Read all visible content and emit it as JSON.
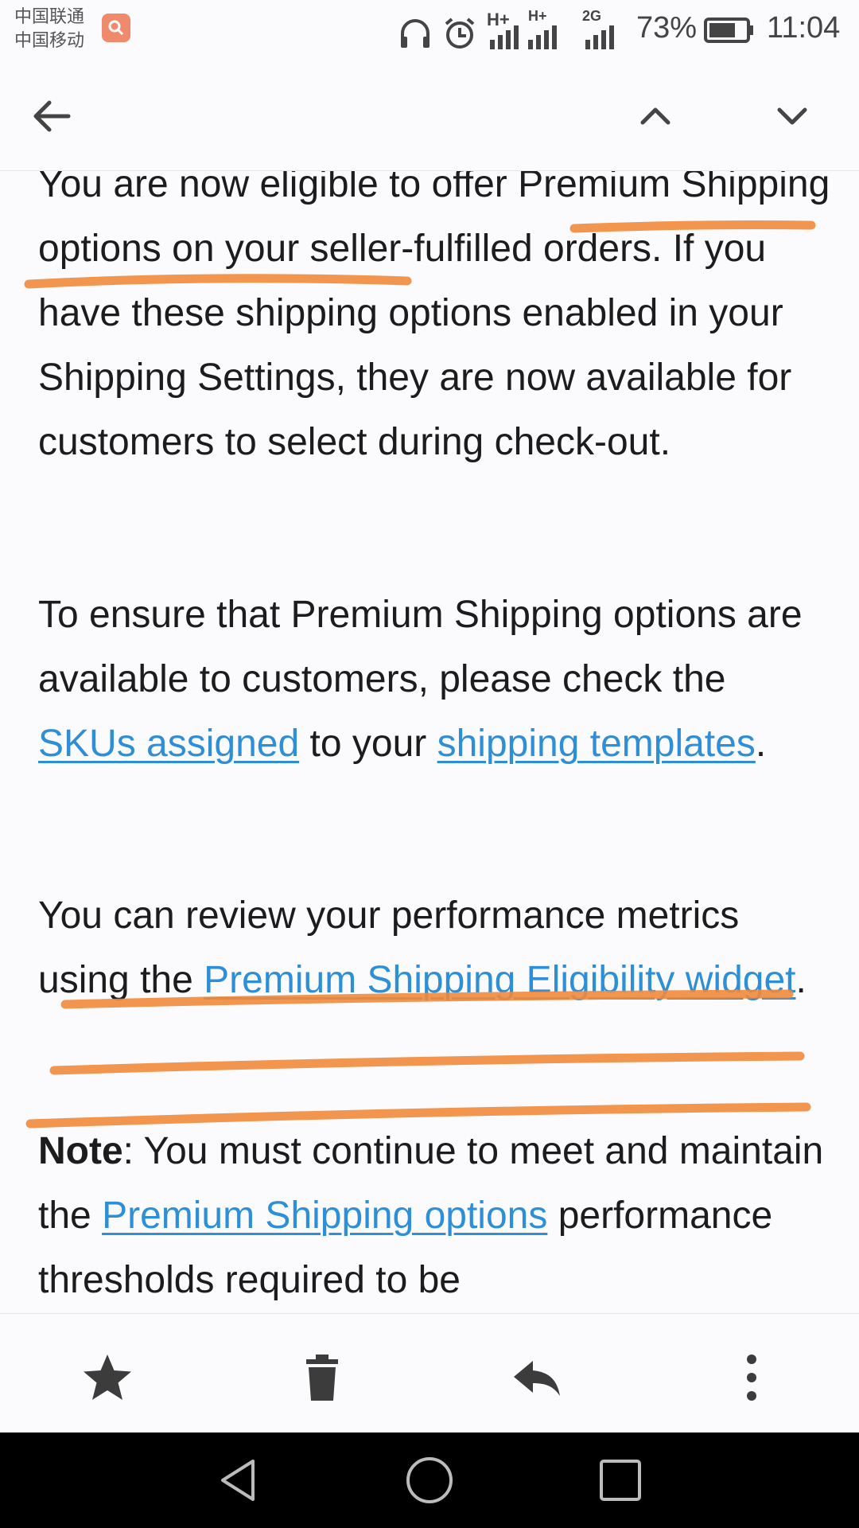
{
  "status_bar": {
    "carrier_1": "中国联通",
    "carrier_2": "中国移动",
    "network_1": "H+",
    "network_2": "H+",
    "network_3": "2G",
    "battery_percent": "73%",
    "battery_level": 0.73,
    "time": "11:04",
    "icons": [
      "notification-app-icon",
      "headphones-icon",
      "alarm-icon",
      "signal-icon",
      "battery-icon"
    ]
  },
  "toolbar": {
    "icons": [
      "back-arrow-icon",
      "chevron-up-icon",
      "chevron-down-icon"
    ]
  },
  "email": {
    "p1": "You are now eligible to offer Premium Shipping options on your seller-fulfilled orders. If you have these shipping options enabled in your Shipping Settings, they are now available for customers to select during check-out.",
    "p2_before": "To ensure that Premium Shipping options are available to customers, please check the ",
    "p2_link1": "SKUs assigned",
    "p2_middle": " to your ",
    "p2_link2": "shipping templates",
    "p2_after": ".",
    "p3_before": "You can review your performance metrics using the ",
    "p3_link": "Premium Shipping Eligibility widget",
    "p3_after": ".",
    "p4_bold": "Note",
    "p4_before": ": You must continue to meet and maintain the ",
    "p4_link": "Premium Shipping options",
    "p4_after": " performance thresholds required to be"
  },
  "annotation_color": "#f08a3c",
  "link_color": "#2f8fd6",
  "action_bar": {
    "icons": [
      "star-icon",
      "trash-icon",
      "reply-icon",
      "more-vert-icon"
    ]
  },
  "nav_bar": {
    "icons": [
      "nav-back-icon",
      "nav-home-icon",
      "nav-recents-icon"
    ]
  }
}
